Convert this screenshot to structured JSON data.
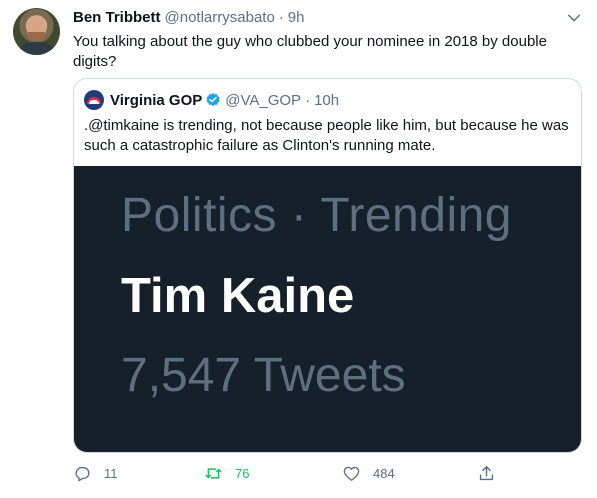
{
  "tweet": {
    "author_name": "Ben Tribbett",
    "author_handle": "@notlarrysabato",
    "separator": "·",
    "time": "9h",
    "text": "You talking about the guy who clubbed your nominee in 2018 by double digits?"
  },
  "quoted": {
    "author_name": "Virginia GOP",
    "verified": true,
    "author_handle": "@VA_GOP",
    "separator": "·",
    "time": "10h",
    "text": ".@timkaine is trending, not because people like him, but because he was such a catastrophic failure as Clinton's running mate.",
    "media": {
      "line1": "Politics · Trending",
      "line2": "Tim Kaine",
      "line3": "7,547 Tweets"
    }
  },
  "actions": {
    "reply_count": "11",
    "retweet_count": "76",
    "like_count": "484"
  },
  "icons": {
    "caret": "chevron-down-icon",
    "verified": "verified-badge-icon",
    "reply": "reply-icon",
    "retweet": "retweet-icon",
    "like": "heart-icon",
    "share": "share-icon"
  },
  "colors": {
    "accent": "#1da1f2",
    "retweet_active": "#17bf63",
    "secondary_text": "#5b7083",
    "media_background": "#15202b"
  }
}
